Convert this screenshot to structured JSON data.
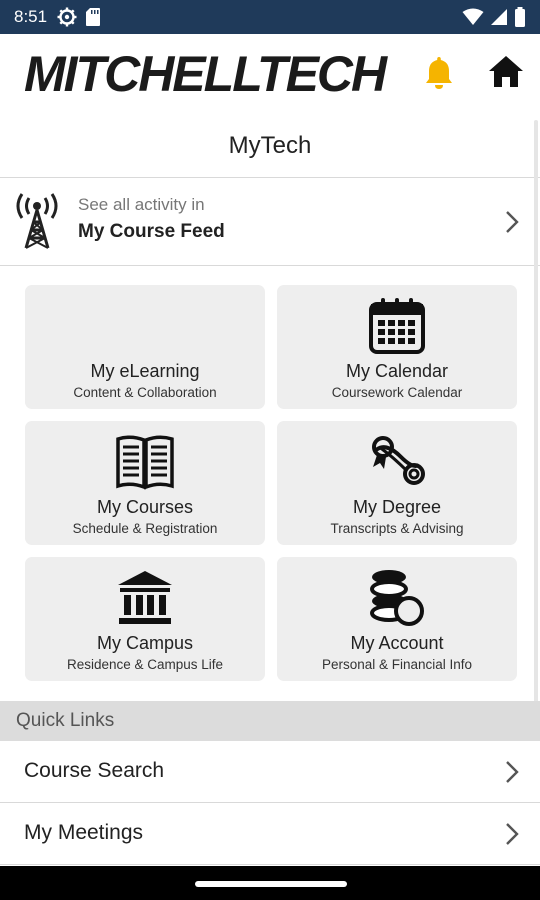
{
  "status": {
    "time": "8:51"
  },
  "header": {
    "logo": "MITCHELLTECH"
  },
  "title": "MyTech",
  "feed": {
    "sub": "See all activity in",
    "main": "My Course Feed"
  },
  "tiles": [
    {
      "title": "My eLearning",
      "sub": "Content & Collaboration",
      "icon": ""
    },
    {
      "title": "My Calendar",
      "sub": "Coursework Calendar",
      "icon": "calendar-icon"
    },
    {
      "title": "My Courses",
      "sub": "Schedule & Registration",
      "icon": "book-icon"
    },
    {
      "title": "My Degree",
      "sub": "Transcripts & Advising",
      "icon": "diploma-icon"
    },
    {
      "title": "My Campus",
      "sub": "Residence & Campus Life",
      "icon": "building-icon"
    },
    {
      "title": "My Account",
      "sub": "Personal & Financial Info",
      "icon": "coins-icon"
    }
  ],
  "quick_links": {
    "header": "Quick Links",
    "items": [
      {
        "label": "Course Search"
      },
      {
        "label": "My Meetings"
      }
    ]
  },
  "colors": {
    "status_bar": "#1f3a5a",
    "bell": "#f5b400",
    "tile_bg": "#eeeeee",
    "section_bg": "#dcdcdc"
  }
}
